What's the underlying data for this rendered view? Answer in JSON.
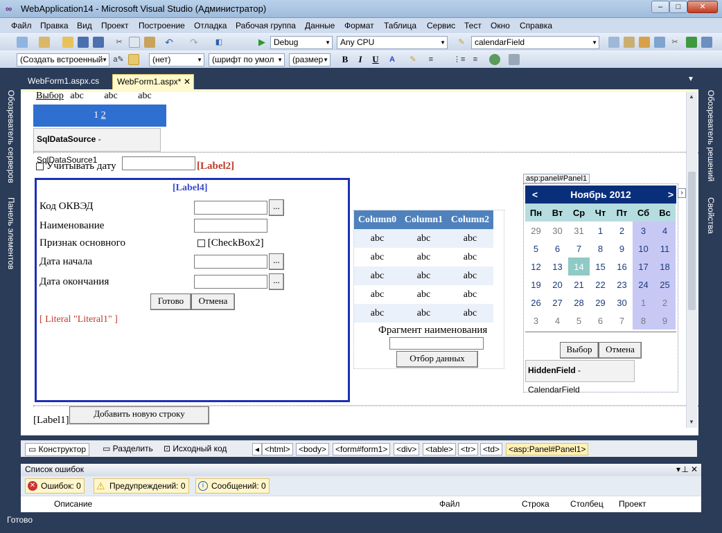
{
  "window": {
    "title": "WebApplication14 - Microsoft Visual Studio (Администратор)",
    "min_label": "–",
    "max_label": "□",
    "close_label": "✕"
  },
  "menu": [
    "Файл",
    "Правка",
    "Вид",
    "Проект",
    "Построение",
    "Отладка",
    "Рабочая группа",
    "Данные",
    "Формат",
    "Таблица",
    "Сервис",
    "Тест",
    "Окно",
    "Справка"
  ],
  "toolbar1": {
    "config": "Debug",
    "platform": "Any CPU",
    "find": "calendarField"
  },
  "toolbar2": {
    "block": "(Создать встроенный",
    "class": "(нет)",
    "font": "(шрифт по умол",
    "size": "(размер",
    "bold": "B",
    "italic": "I",
    "underline": "U"
  },
  "side_left": [
    "Обозреватель серверов",
    "Панель элементов"
  ],
  "side_right": [
    "Обозреватель решений",
    "Свойства"
  ],
  "tabs": [
    {
      "label": "WebForm1.aspx.cs"
    },
    {
      "label": "WebForm1.aspx*"
    }
  ],
  "tab_close": "✕",
  "designer": {
    "select_link": "Выбор",
    "abc": "abc",
    "pager": "1",
    "pager2": "2",
    "datasource_bold": "SqlDataSource",
    "datasource_rest": " - SqlDataSource1",
    "checkbox_label": "Учитывать дату",
    "label2": "[Label2]",
    "label4": "[Label4]",
    "form_rows": [
      "Код ОКВЭД",
      "Наименование",
      "Признак основного",
      "Дата начала",
      "Дата окончания"
    ],
    "checkbox2": "[CheckBox2]",
    "ellipsis": "...",
    "ok": "Готово",
    "cancel": "Отмена",
    "literal": "[ Literal \"Literal1\" ]",
    "grid_headers": [
      "Column0",
      "Column1",
      "Column2"
    ],
    "grid_cell": "abc",
    "fragment_label": "Фрагмент наименования",
    "filter_button": "Отбор данных",
    "panel_tag": "asp:panel#Panel1",
    "calendar": {
      "title": "Ноябрь 2012",
      "prev": "<",
      "next": ">",
      "days": [
        "Пн",
        "Вт",
        "Ср",
        "Чт",
        "Пт",
        "Сб",
        "Вс"
      ],
      "weeks": [
        [
          "29",
          "30",
          "31",
          "1",
          "2",
          "3",
          "4"
        ],
        [
          "5",
          "6",
          "7",
          "8",
          "9",
          "10",
          "11"
        ],
        [
          "12",
          "13",
          "14",
          "15",
          "16",
          "17",
          "18"
        ],
        [
          "19",
          "20",
          "21",
          "22",
          "23",
          "24",
          "25"
        ],
        [
          "26",
          "27",
          "28",
          "29",
          "30",
          "1",
          "2"
        ],
        [
          "3",
          "4",
          "5",
          "6",
          "7",
          "8",
          "9"
        ]
      ],
      "selected": "14",
      "colors": {
        "header": "#0a2f7a",
        "weekend": "#c8c8f5",
        "selected": "#8fcac5",
        "days_bg": "#b5dde0"
      }
    },
    "choose": "Выбор",
    "cancel2": "Отмена",
    "hiddenfield_bold": "HiddenField",
    "hiddenfield_rest": " - CalendarField",
    "label1": "[Label1]",
    "add_row": "Добавить новую строку"
  },
  "viewbar": {
    "design": "Конструктор",
    "split": "Разделить",
    "source": "Исходный код",
    "crumbs": [
      "<html>",
      "<body>",
      "<form#form1>",
      "<div>",
      "<table>",
      "<tr>",
      "<td>"
    ],
    "active_crumb": "<asp:Panel#Panel1>"
  },
  "errors": {
    "title": "Список ошибок",
    "errors": "Ошибок: 0",
    "warnings": "Предупреждений: 0",
    "messages": "Сообщений: 0",
    "columns": [
      "Описание",
      "Файл",
      "Строка",
      "Столбец",
      "Проект"
    ]
  },
  "status": "Готово"
}
